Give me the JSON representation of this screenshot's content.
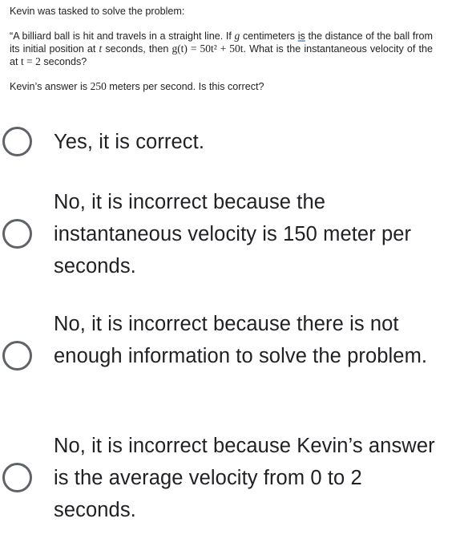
{
  "question": {
    "intro": "Kevin was tasked to solve the problem:",
    "problem": {
      "part1": "“A billiard ball is hit and travels in a straight line. If ",
      "var_g": "g",
      "part2": " centimeters ",
      "flagged_word": "is",
      "part3": " the distance of the ball from its initial position at ",
      "var_t": "t",
      "part4": " seconds, then ",
      "equation": "g(t) = 50t² + 50t",
      "part5": ". What is the instantaneous velocity of the at ",
      "t_equals": "t = 2",
      "part6": " seconds?"
    },
    "claim": {
      "before": "Kevin’s answer is ",
      "value": "250",
      "after": " meters per second. Is this correct?"
    }
  },
  "options": [
    {
      "label": "Yes, it is correct.",
      "selected": false
    },
    {
      "label": "No, it is incorrect because the instantaneous velocity is 150 meter per seconds.",
      "selected": false
    },
    {
      "label": "No, it is incorrect because there is not enough information to solve the problem.",
      "selected": false
    },
    {
      "label": "No, it is incorrect because Kevin’s answer is the average velocity from 0 to 2 seconds.",
      "selected": false
    }
  ]
}
